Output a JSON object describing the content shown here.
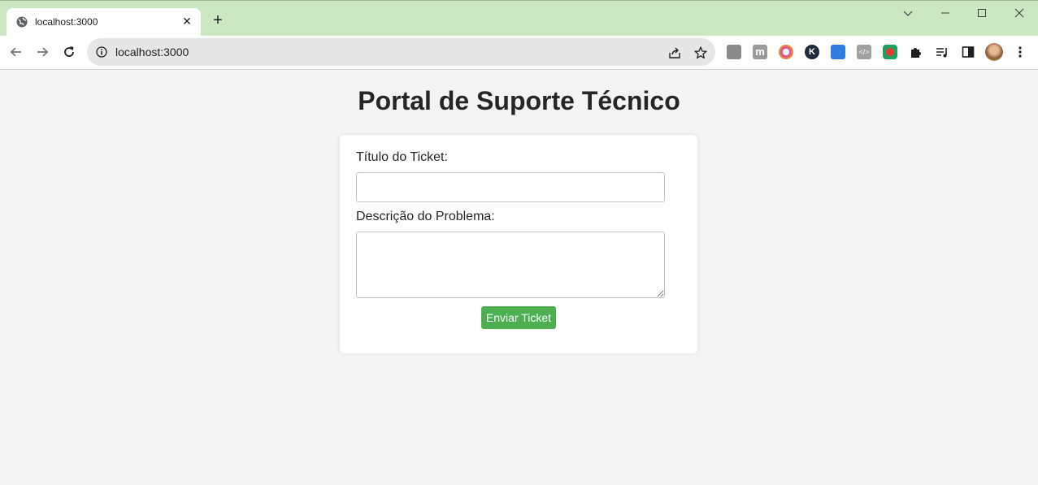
{
  "browser": {
    "tab_title": "localhost:3000",
    "address": "localhost:3000",
    "icons": {
      "back": "arrow-left-icon",
      "forward": "arrow-right-icon",
      "reload": "reload-icon",
      "site_info": "info-icon",
      "share": "share-icon",
      "bookmark": "star-icon",
      "extensions": "puzzle-icon",
      "media": "media-queue-icon",
      "side_panel": "side-panel-icon",
      "menu": "kebab-menu-icon"
    }
  },
  "page": {
    "title": "Portal de Suporte Técnico",
    "form": {
      "ticket_title_label": "Título do Ticket:",
      "ticket_title_value": "",
      "description_label": "Descrição do Problema:",
      "description_value": "",
      "submit_label": "Enviar Ticket"
    }
  },
  "colors": {
    "titlebar": "#cbe8c2",
    "accent_button": "#4caf50",
    "page_background": "#f4f4f4"
  }
}
